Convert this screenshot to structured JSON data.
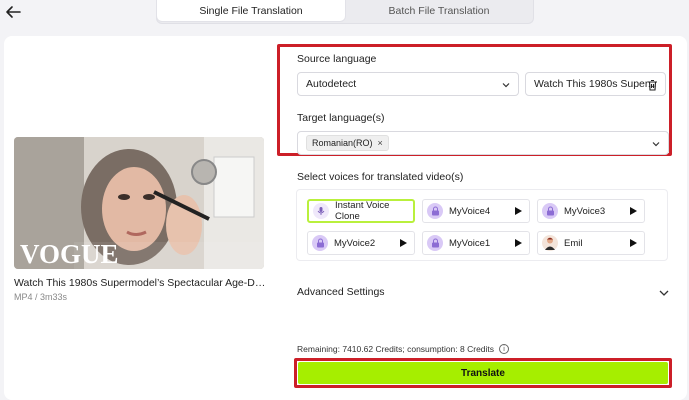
{
  "nav": {
    "back_icon": "arrow-left-icon"
  },
  "tabs": [
    {
      "label": "Single File Translation",
      "active": true
    },
    {
      "label": "Batch File Translation",
      "active": false
    }
  ],
  "video": {
    "title": "Watch This 1980s Supermodel’s Spectacular Age-Defying...",
    "meta": "MP4 / 3m33s",
    "thumbnail_text": "VOGUE"
  },
  "source": {
    "label": "Source language",
    "value": "Autodetect",
    "file_value": "Watch This 1980s Super...",
    "delete_icon": "trash-icon"
  },
  "target": {
    "label": "Target language(s)",
    "chips": [
      {
        "label": "Romanian(RO)",
        "remove": "×"
      }
    ]
  },
  "voices": {
    "label": "Select voices for translated video(s)",
    "items": [
      {
        "label": "Instant Voice Clone",
        "selected": true,
        "icon": "voice-clone-icon"
      },
      {
        "label": "MyVoice4",
        "selected": false,
        "icon": "lock-avatar-icon"
      },
      {
        "label": "MyVoice3",
        "selected": false,
        "icon": "lock-avatar-icon"
      },
      {
        "label": "MyVoice2",
        "selected": false,
        "icon": "lock-avatar-icon"
      },
      {
        "label": "MyVoice1",
        "selected": false,
        "icon": "lock-avatar-icon"
      },
      {
        "label": "Emil",
        "selected": false,
        "icon": "person-avatar-icon"
      }
    ]
  },
  "advanced": {
    "label": "Advanced Settings"
  },
  "credits": {
    "text": "Remaining: 7410.62 Credits; consumption: 8 Credits",
    "info": "i"
  },
  "translate": {
    "label": "Translate"
  },
  "colors": {
    "accent": "#a6ee00",
    "highlight_border": "#cc1f28",
    "selected_voice_border": "#b9f03c",
    "lock_avatar": "#c9b2f0"
  }
}
